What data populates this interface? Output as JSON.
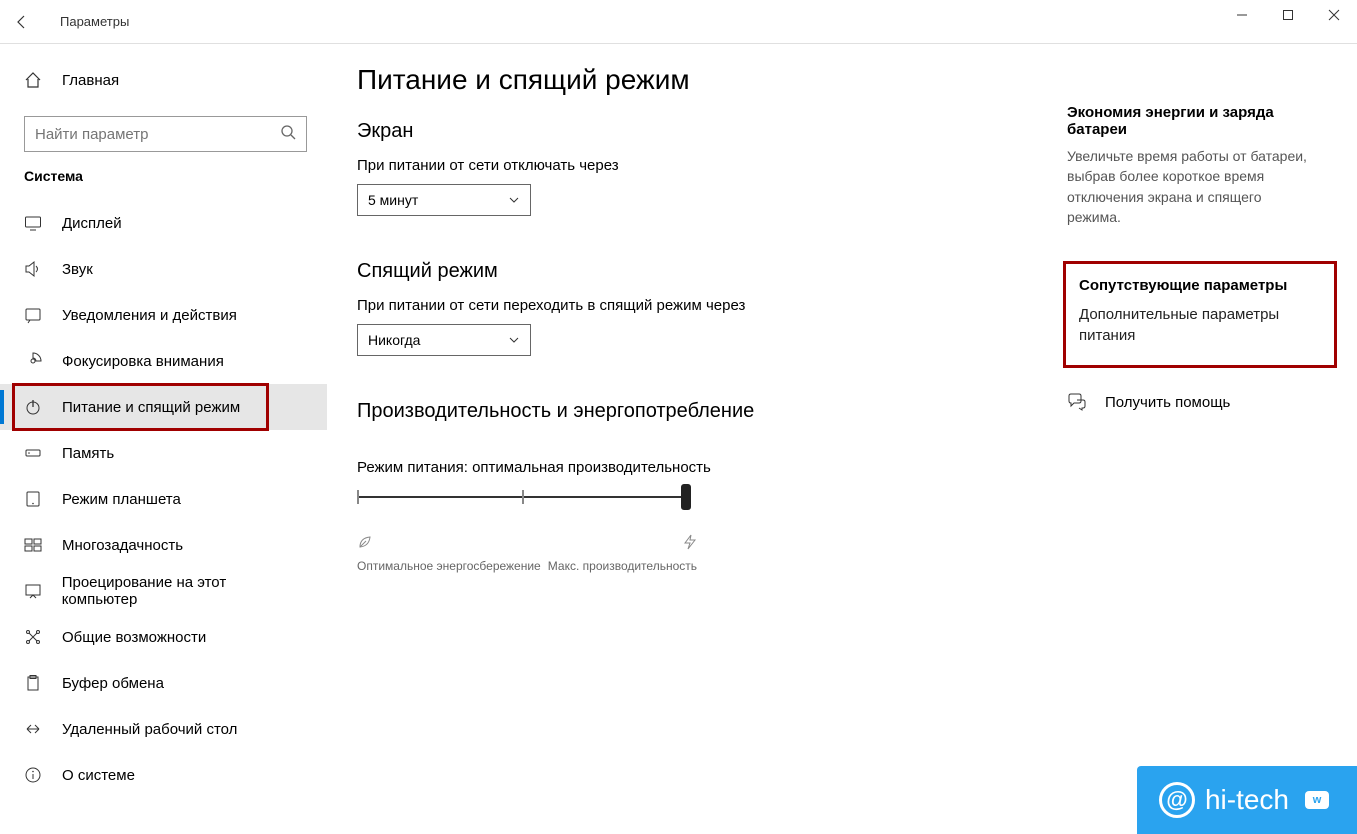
{
  "window": {
    "title": "Параметры"
  },
  "sidebar": {
    "home": "Главная",
    "search_placeholder": "Найти параметр",
    "category": "Система",
    "items": [
      {
        "label": "Дисплей",
        "icon": "display-icon"
      },
      {
        "label": "Звук",
        "icon": "sound-icon"
      },
      {
        "label": "Уведомления и действия",
        "icon": "notifications-icon"
      },
      {
        "label": "Фокусировка внимания",
        "icon": "focus-assist-icon"
      },
      {
        "label": "Питание и спящий режим",
        "icon": "power-icon"
      },
      {
        "label": "Память",
        "icon": "storage-icon"
      },
      {
        "label": "Режим планшета",
        "icon": "tablet-mode-icon"
      },
      {
        "label": "Многозадачность",
        "icon": "multitasking-icon"
      },
      {
        "label": "Проецирование на этот компьютер",
        "icon": "projecting-icon"
      },
      {
        "label": "Общие возможности",
        "icon": "shared-experiences-icon"
      },
      {
        "label": "Буфер обмена",
        "icon": "clipboard-icon"
      },
      {
        "label": "Удаленный рабочий стол",
        "icon": "remote-desktop-icon"
      },
      {
        "label": "О системе",
        "icon": "about-icon"
      }
    ]
  },
  "main": {
    "title": "Питание и спящий режим",
    "screen": {
      "heading": "Экран",
      "label": "При питании от сети отключать через",
      "value": "5 минут"
    },
    "sleep": {
      "heading": "Спящий режим",
      "label": "При питании от сети переходить в спящий режим через",
      "value": "Никогда"
    },
    "perf": {
      "heading": "Производительность и энергопотребление",
      "mode_label": "Режим питания: оптимальная производительность",
      "min_label": "Оптимальное энергосбережение",
      "max_label": "Макс. производительность"
    }
  },
  "right": {
    "battery": {
      "heading": "Экономия энергии и заряда батареи",
      "text": "Увеличьте время работы от батареи, выбрав более короткое время отключения экрана и спящего режима."
    },
    "related": {
      "heading": "Сопутствующие параметры",
      "link": "Дополнительные параметры питания"
    },
    "help": "Получить помощь"
  },
  "watermark": {
    "text": "hi-tech"
  }
}
